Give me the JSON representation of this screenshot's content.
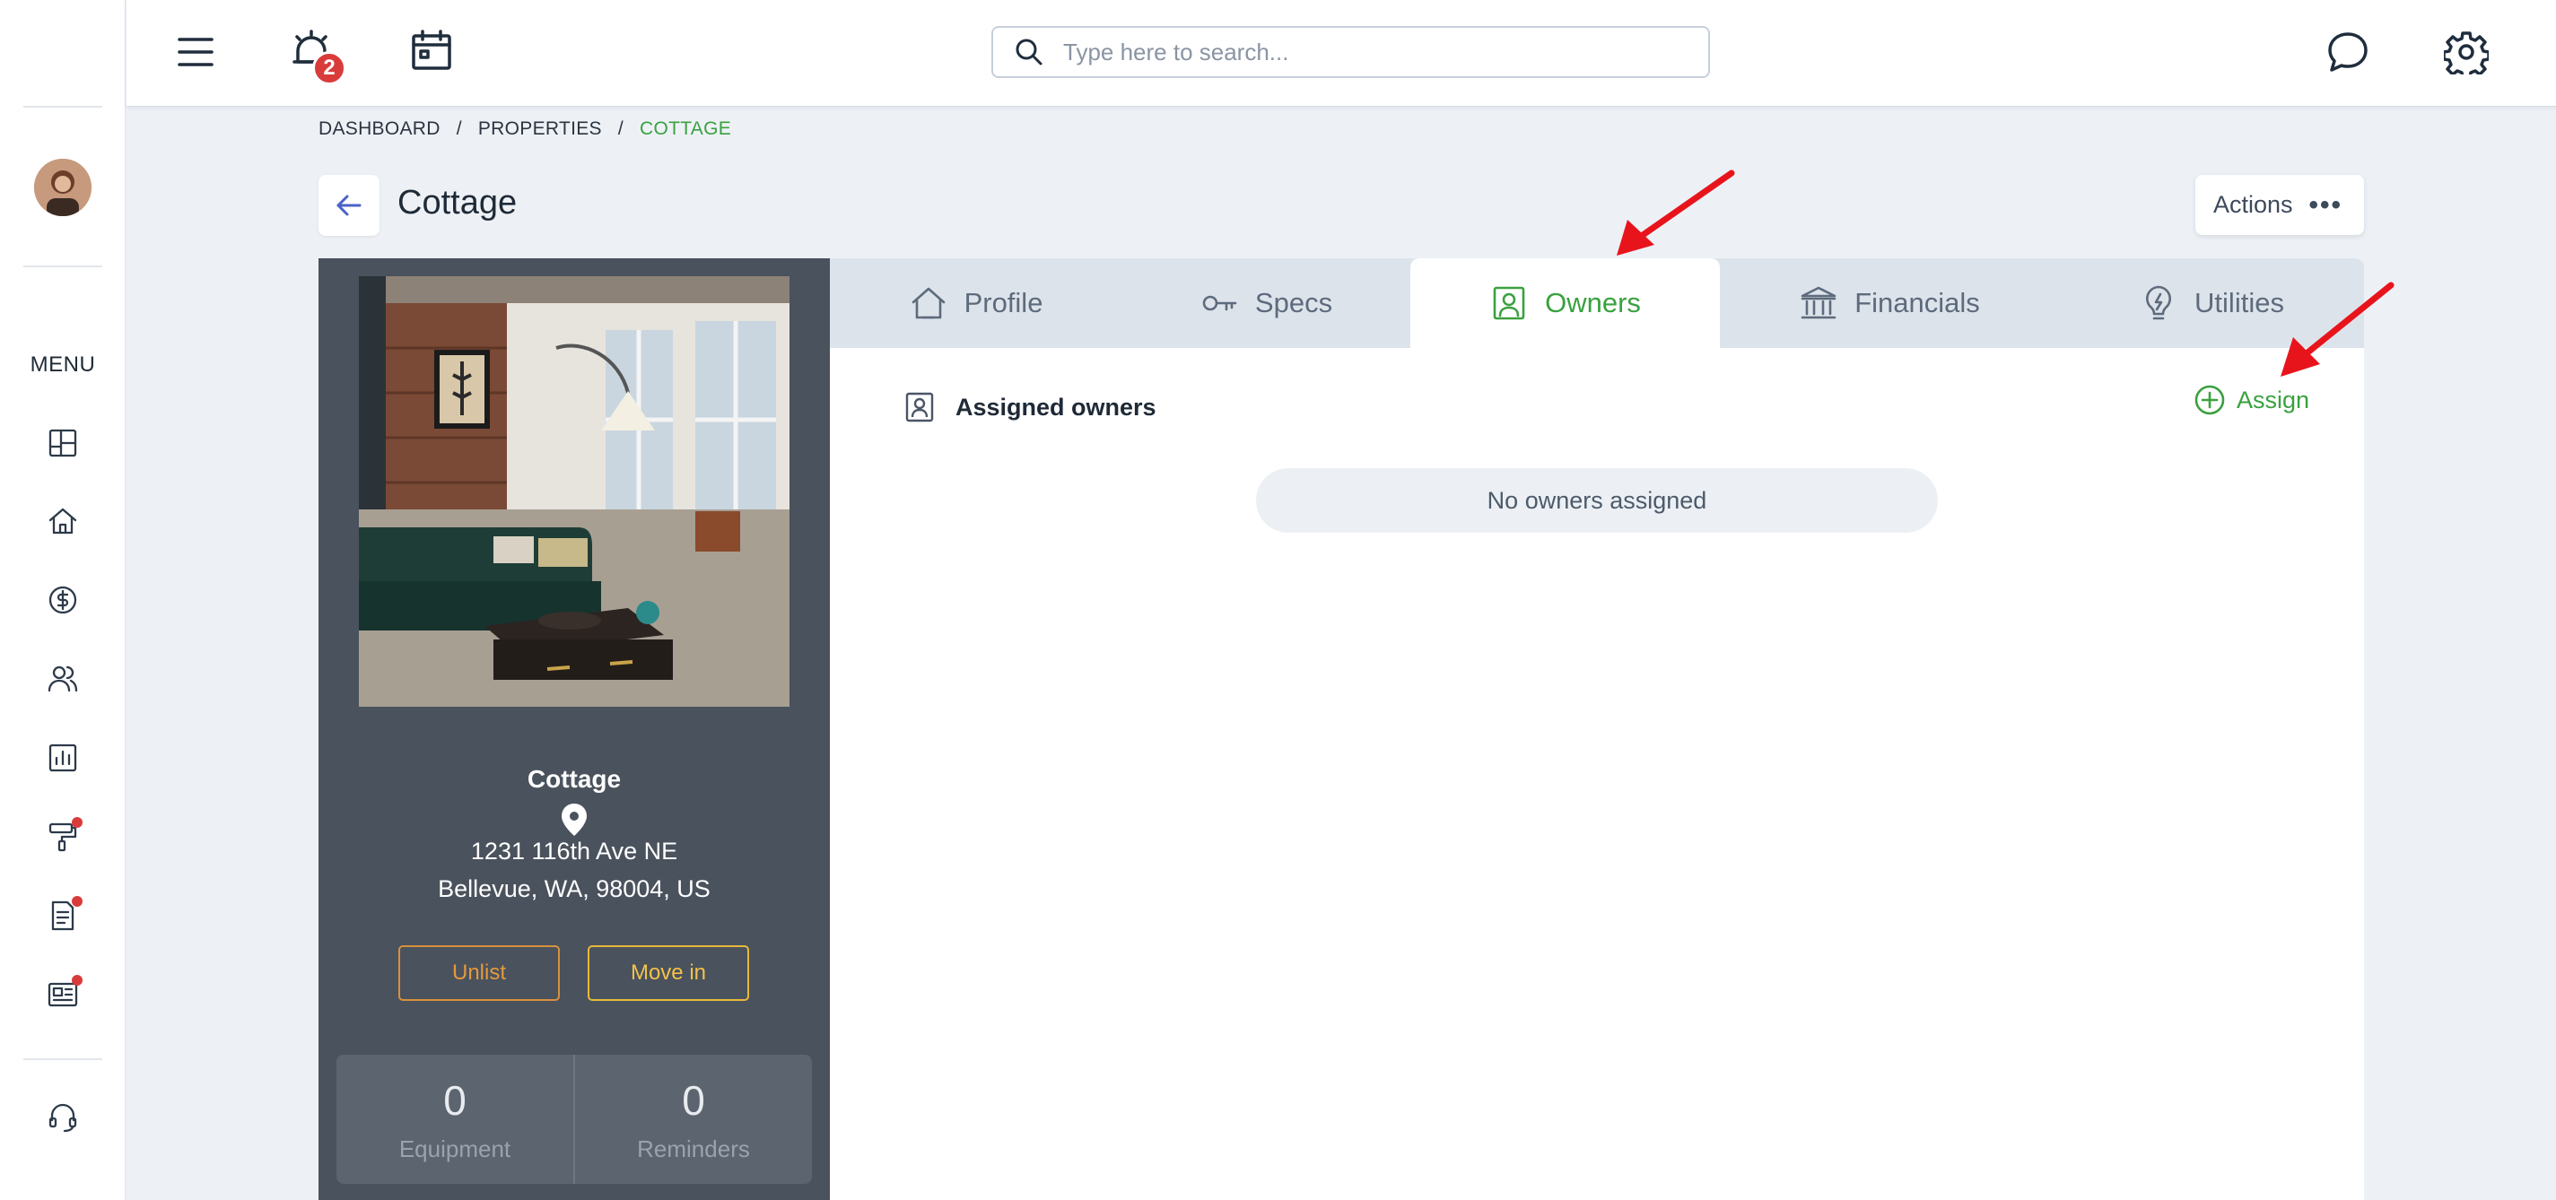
{
  "sidebar": {
    "menu_label": "MENU",
    "items": [
      {
        "icon": "dashboard-icon"
      },
      {
        "icon": "home-icon"
      },
      {
        "icon": "dollar-icon"
      },
      {
        "icon": "users-icon"
      },
      {
        "icon": "reports-icon"
      },
      {
        "icon": "paint-roller-icon",
        "has_dot": true
      },
      {
        "icon": "document-icon",
        "has_dot": true
      },
      {
        "icon": "newspaper-icon",
        "has_dot": true
      },
      {
        "icon": "headset-icon"
      }
    ]
  },
  "topbar": {
    "notification_count": "2",
    "search_placeholder": "Type here to search..."
  },
  "breadcrumb": {
    "items": [
      "DASHBOARD",
      "PROPERTIES"
    ],
    "current": "COTTAGE",
    "separator": "/"
  },
  "page": {
    "title": "Cottage",
    "actions_label": "Actions"
  },
  "property": {
    "name": "Cottage",
    "address_line1": "1231 116th Ave NE",
    "address_line2": "Bellevue, WA, 98004, US",
    "unlist_label": "Unlist",
    "move_in_label": "Move in",
    "equipment_count": "0",
    "equipment_label": "Equipment",
    "reminders_count": "0",
    "reminders_label": "Reminders"
  },
  "tabs": [
    {
      "label": "Profile",
      "icon": "house-icon"
    },
    {
      "label": "Specs",
      "icon": "key-icon"
    },
    {
      "label": "Owners",
      "icon": "owner-badge-icon",
      "active": true
    },
    {
      "label": "Financials",
      "icon": "bank-icon"
    },
    {
      "label": "Utilities",
      "icon": "lightbulb-icon"
    }
  ],
  "owners": {
    "section_title": "Assigned owners",
    "assign_label": "Assign",
    "empty_message": "No owners assigned"
  },
  "colors": {
    "accent_green": "#3aa13f",
    "card_bg": "#4a525d",
    "alert_red": "#d93b3b",
    "annotation_arrow": "#e8141c"
  }
}
